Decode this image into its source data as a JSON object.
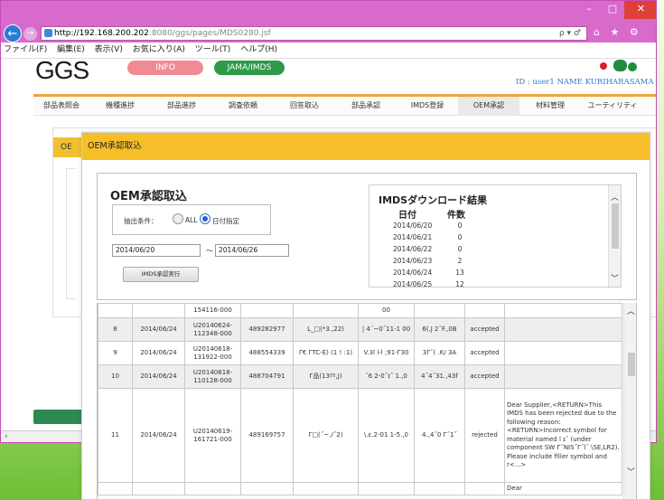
{
  "browser": {
    "url_host": "http://192.168.200.202",
    "url_rest": ":8080/ggs/pages/MDS0280.jsf",
    "url_tools": "ρ ▾ ♂",
    "window_controls": [
      "–",
      "□",
      "✕"
    ],
    "tool_icons": "⌂ ★ ⚙",
    "menu": [
      "ファイル(F)",
      "編集(E)",
      "表示(V)",
      "お気に入り(A)",
      "ツール(T)",
      "ヘルプ(H)"
    ]
  },
  "app": {
    "logo": "GGS",
    "info_label": "INFO",
    "jama_label": "JAMA/IMDS",
    "user_line": "ID : user1 NAME KURIHARASAMA",
    "colors": {
      "accent_orange": "#f0a43a",
      "header_yellow": "#f6bf2a",
      "info_pink": "#f08a94",
      "jama_green": "#2e9a4a"
    }
  },
  "nav": {
    "tabs": [
      "部品表照会",
      "機種進捗",
      "部品進捗",
      "調査依頼",
      "回答取込",
      "部品承認",
      "IMDS登録",
      "OEM承認",
      "材料管理",
      "ユーティリティ"
    ],
    "active": "OEM承認"
  },
  "back_page": {
    "tab_label": "OE"
  },
  "modal": {
    "title": "OEM承認取込",
    "section_title": "OEM承認取込",
    "filter_label": "抽出条件：",
    "radio_all": "ALL",
    "radio_date": "日付指定",
    "date_from": "2014/06/20",
    "tilde": "～",
    "date_to": "2014/06/26",
    "exec_button": "IMDS承認実行",
    "download": {
      "title": "IMDSダウンロード結果",
      "col_date": "日付",
      "col_count": "件数",
      "rows": [
        {
          "date": "2014/06/20",
          "count": "0"
        },
        {
          "date": "2014/06/21",
          "count": "0"
        },
        {
          "date": "2014/06/22",
          "count": "0"
        },
        {
          "date": "2014/06/23",
          "count": "2"
        },
        {
          "date": "2014/06/24",
          "count": "13"
        },
        {
          "date": "2014/06/25",
          "count": "12"
        }
      ]
    },
    "table": {
      "partial_top": {
        "code": "154116-000",
        "partial": "00"
      },
      "rows": [
        {
          "no": "8",
          "date": "2014/06/24",
          "code": "U20140624-112348-000",
          "id": "489282977",
          "name": "L_□(*3.,22)",
          "part": "| 4´~0˝11-1 00",
          "supplier": "6(.J 2˝F.,0B",
          "status": "accepted",
          "msg": ""
        },
        {
          "no": "9",
          "date": "2014/06/24",
          "code": "U20140618-131922-000",
          "id": "488554339",
          "name": "Γ€ ΓTC-E) (1 ! :1)",
          "part": "V.3l l-l ;91-Γ30",
          "supplier": "3Γ˝( .K/ 3A",
          "status": "accepted",
          "msg": ""
        },
        {
          "no": "10",
          "date": "2014/06/24",
          "code": "U20140618-110128-000",
          "id": "488704791",
          "name": "Γ品(13ºº,J)",
          "part": "˝6 2-0˝ɪ˝ 1.,0",
          "supplier": "4˝4˝31.,43f",
          "status": "accepted",
          "msg": ""
        },
        {
          "no": "11",
          "date": "2014/06/24",
          "code": "U20140619-161721-000",
          "id": "489169757",
          "name": "Γ□(˝~./˝2)",
          "part": "\\.ɛ.2-01 1-5.,0",
          "supplier": "4.,4˝0 Γ˝1˝",
          "status": "rejected",
          "msg": "Dear Supplier,<RETURN>This IMDS has been rejected due to the following reason:<RETURN>Incorrect symbol for material named l ɪ˝ (under component SW Γ˝NIS˝Γ˝l˝ \\SE,LR2). Please include filler symbol and r<...>"
        }
      ],
      "partial_bottom": "Dear"
    }
  }
}
